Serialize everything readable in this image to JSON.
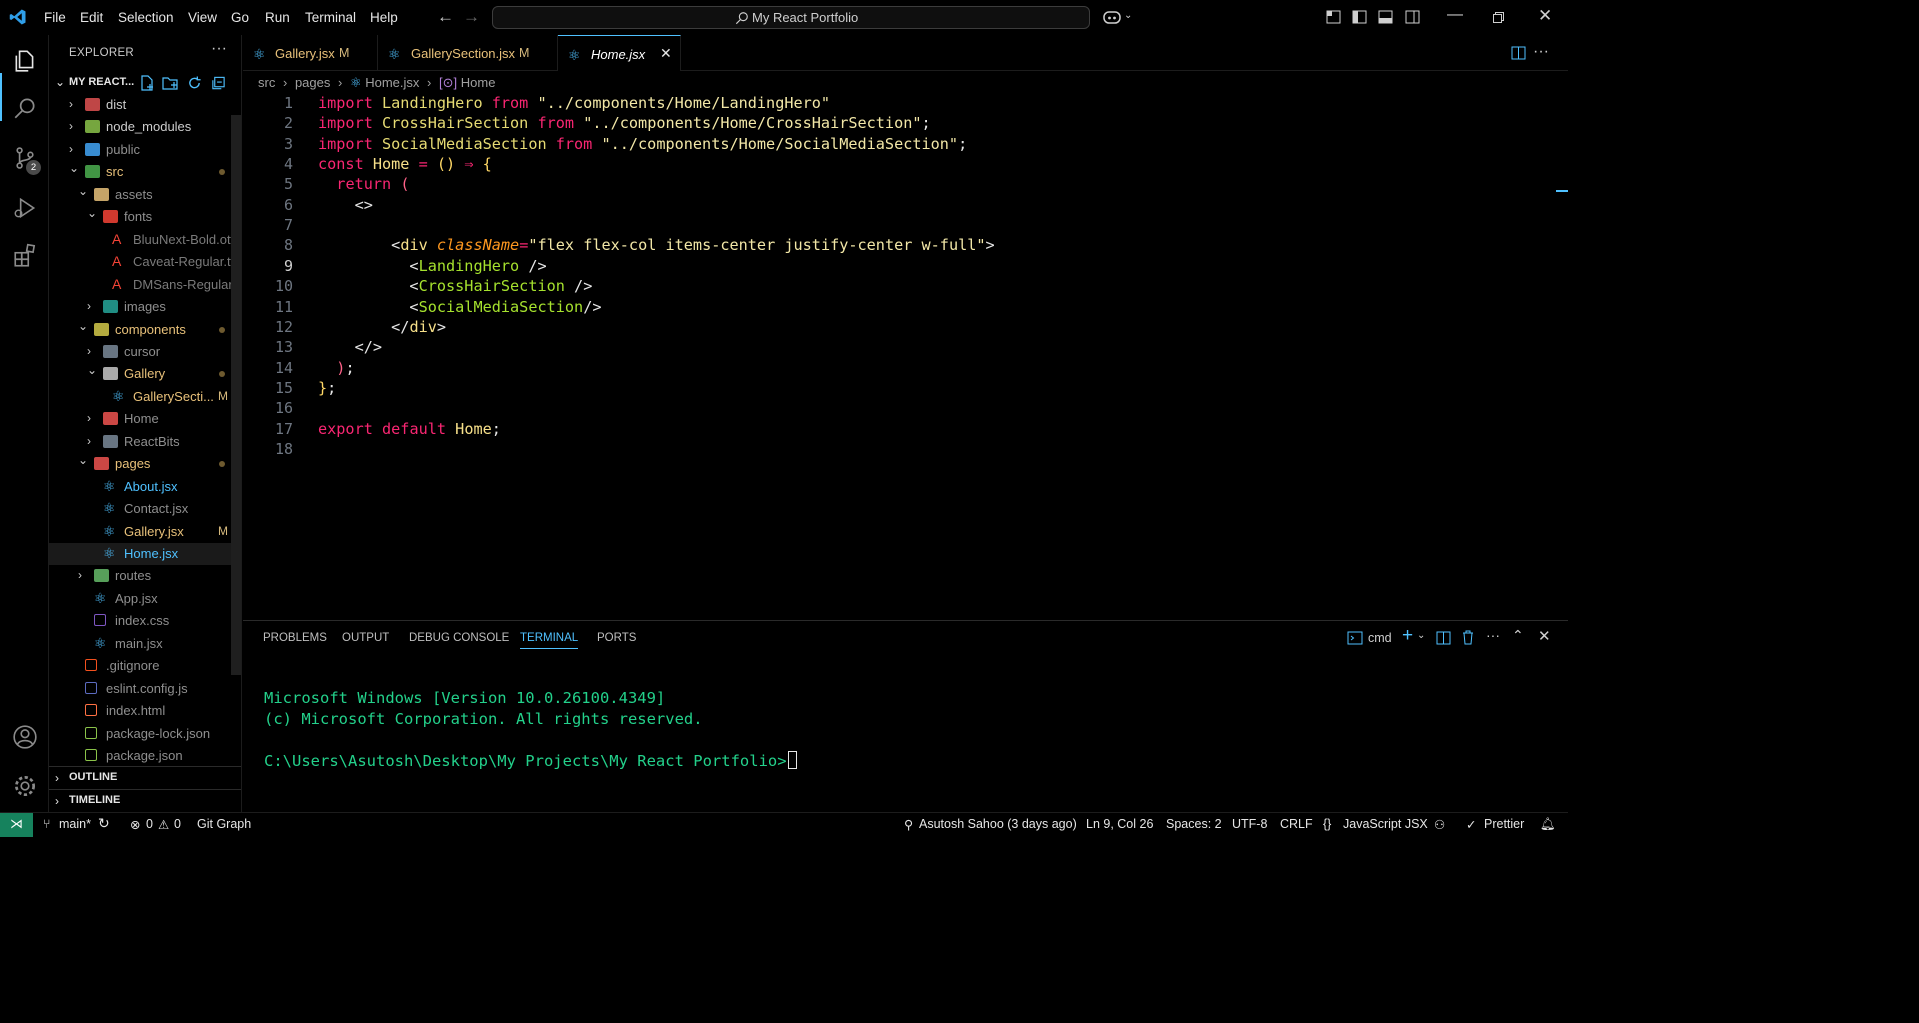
{
  "menu": [
    "File",
    "Edit",
    "Selection",
    "View",
    "Go",
    "Run",
    "Terminal",
    "Help"
  ],
  "search": {
    "text": "My React Portfolio"
  },
  "sidebar": {
    "title": "EXPLORER",
    "project": "MY REACT...",
    "outline": "OUTLINE",
    "timeline": "TIMELINE",
    "tree": [
      {
        "label": "dist",
        "indent": 0,
        "chev": ">",
        "icon": "folder-dist",
        "color": "#cccccc"
      },
      {
        "label": "node_modules",
        "indent": 0,
        "chev": ">",
        "icon": "folder-node",
        "color": "#cccccc"
      },
      {
        "label": "public",
        "indent": 0,
        "chev": ">",
        "icon": "folder-public",
        "color": "#8f8f8f"
      },
      {
        "label": "src",
        "indent": 0,
        "chev": "v",
        "icon": "folder-src",
        "color": "#e8c17a",
        "dot": true
      },
      {
        "label": "assets",
        "indent": 1,
        "chev": "v",
        "icon": "folder-assets",
        "color": "#8f8f8f"
      },
      {
        "label": "fonts",
        "indent": 2,
        "chev": "v",
        "icon": "folder-fonts",
        "color": "#8f8f8f"
      },
      {
        "label": "BluuNext-Bold.otf",
        "indent": 3,
        "chev": "",
        "icon": "font-file",
        "color": "#7a7a7a"
      },
      {
        "label": "Caveat-Regular.ttf",
        "indent": 3,
        "chev": "",
        "icon": "font-file",
        "color": "#7a7a7a"
      },
      {
        "label": "DMSans-Regular...",
        "indent": 3,
        "chev": "",
        "icon": "font-file",
        "color": "#7a7a7a"
      },
      {
        "label": "images",
        "indent": 2,
        "chev": ">",
        "icon": "folder-images",
        "color": "#8f8f8f"
      },
      {
        "label": "components",
        "indent": 1,
        "chev": "v",
        "icon": "folder-components",
        "color": "#e8c17a",
        "dot": true
      },
      {
        "label": "cursor",
        "indent": 2,
        "chev": ">",
        "icon": "folder-plain",
        "color": "#8f8f8f"
      },
      {
        "label": "Gallery",
        "indent": 2,
        "chev": "v",
        "icon": "folder-gallery",
        "color": "#e8c17a",
        "dot": true
      },
      {
        "label": "GallerySecti...",
        "indent": 3,
        "chev": "",
        "icon": "react-file",
        "color": "#e8c17a",
        "badge": "M"
      },
      {
        "label": "Home",
        "indent": 2,
        "chev": ">",
        "icon": "folder-home",
        "color": "#8f8f8f"
      },
      {
        "label": "ReactBits",
        "indent": 2,
        "chev": ">",
        "icon": "folder-plain",
        "color": "#8f8f8f"
      },
      {
        "label": "pages",
        "indent": 1,
        "chev": "v",
        "icon": "folder-pages",
        "color": "#e8c17a",
        "dot": true
      },
      {
        "label": "About.jsx",
        "indent": 2,
        "chev": "",
        "icon": "react-file",
        "color": "#4fc1ff"
      },
      {
        "label": "Contact.jsx",
        "indent": 2,
        "chev": "",
        "icon": "react-file",
        "color": "#8f8f8f"
      },
      {
        "label": "Gallery.jsx",
        "indent": 2,
        "chev": "",
        "icon": "react-file",
        "color": "#e8c17a",
        "badge": "M"
      },
      {
        "label": "Home.jsx",
        "indent": 2,
        "chev": "",
        "icon": "react-file",
        "color": "#4fc1ff",
        "selected": true
      },
      {
        "label": "routes",
        "indent": 1,
        "chev": ">",
        "icon": "folder-routes",
        "color": "#8f8f8f"
      },
      {
        "label": "App.jsx",
        "indent": 1,
        "chev": "",
        "icon": "react-file",
        "color": "#8f8f8f"
      },
      {
        "label": "index.css",
        "indent": 1,
        "chev": "",
        "icon": "css-file",
        "color": "#8f8f8f"
      },
      {
        "label": "main.jsx",
        "indent": 1,
        "chev": "",
        "icon": "react-file",
        "color": "#8f8f8f"
      },
      {
        "label": ".gitignore",
        "indent": 0,
        "chev": "",
        "icon": "git-file",
        "color": "#8f8f8f"
      },
      {
        "label": "eslint.config.js",
        "indent": 0,
        "chev": "",
        "icon": "eslint-file",
        "color": "#8f8f8f"
      },
      {
        "label": "index.html",
        "indent": 0,
        "chev": "",
        "icon": "html-file",
        "color": "#8f8f8f"
      },
      {
        "label": "package-lock.json",
        "indent": 0,
        "chev": "",
        "icon": "npm-file",
        "color": "#8f8f8f"
      },
      {
        "label": "package.json",
        "indent": 0,
        "chev": "",
        "icon": "npm-file",
        "color": "#8f8f8f"
      }
    ]
  },
  "tabs": [
    {
      "label": "Gallery.jsx",
      "modified": "M",
      "active": false
    },
    {
      "label": "GallerySection.jsx",
      "modified": "M",
      "active": false
    },
    {
      "label": "Home.jsx",
      "modified": "",
      "active": true
    }
  ],
  "breadcrumb": [
    "src",
    "pages",
    "Home.jsx",
    "Home"
  ],
  "editor": {
    "active_line": 9,
    "line_numbers": [
      "1",
      "2",
      "3",
      "4",
      "5",
      "6",
      "7",
      "8",
      "9",
      "10",
      "11",
      "12",
      "13",
      "14",
      "15",
      "16",
      "17",
      "18"
    ],
    "lines": [
      [
        [
          "kw",
          "import "
        ],
        [
          "id",
          "LandingHero "
        ],
        [
          "kw",
          "from "
        ],
        [
          "strw",
          "\"../components/Home/LandingHero\""
        ]
      ],
      [
        [
          "kw",
          "import "
        ],
        [
          "id",
          "CrossHairSection "
        ],
        [
          "kw",
          "from "
        ],
        [
          "strw",
          "\"../components/Home/CrossHairSection\""
        ],
        [
          "pun",
          ";"
        ]
      ],
      [
        [
          "kw",
          "import "
        ],
        [
          "id",
          "SocialMediaSection "
        ],
        [
          "kw",
          "from "
        ],
        [
          "strw",
          "\"../components/Home/SocialMediaSection\""
        ],
        [
          "pun",
          ";"
        ]
      ],
      [
        [
          "kw",
          "const "
        ],
        [
          "idy",
          "Home "
        ],
        [
          "kw",
          "= "
        ],
        [
          "paren",
          "() "
        ],
        [
          "kw",
          "⇒ "
        ],
        [
          "paren",
          "{"
        ]
      ],
      [
        [
          "pun",
          "  "
        ],
        [
          "kw",
          "return "
        ],
        [
          "pink",
          "("
        ]
      ],
      [
        [
          "pun",
          "    "
        ],
        [
          "pun",
          "<>"
        ]
      ],
      [
        [
          "pun",
          ""
        ]
      ],
      [
        [
          "pun",
          "        "
        ],
        [
          "pun",
          "<"
        ],
        [
          "idy",
          "div "
        ],
        [
          "attr",
          "className"
        ],
        [
          "kw",
          "="
        ],
        [
          "strw",
          "\"flex flex-col items-center justify-center w-full\""
        ],
        [
          "pun",
          ">"
        ]
      ],
      [
        [
          "pun",
          "          <"
        ],
        [
          "comp",
          "LandingHero "
        ],
        [
          "pun",
          "/>"
        ]
      ],
      [
        [
          "pun",
          "          <"
        ],
        [
          "comp",
          "CrossHairSection "
        ],
        [
          "pun",
          "/>"
        ]
      ],
      [
        [
          "pun",
          "          <"
        ],
        [
          "comp",
          "SocialMediaSection"
        ],
        [
          "pun",
          "/>"
        ]
      ],
      [
        [
          "pun",
          "        </"
        ],
        [
          "idy",
          "div"
        ],
        [
          "pun",
          ">"
        ]
      ],
      [
        [
          "pun",
          "    </>"
        ]
      ],
      [
        [
          "pun",
          "  "
        ],
        [
          "pink",
          ")"
        ],
        [
          "pun",
          ";"
        ]
      ],
      [
        [
          "paren",
          "}"
        ],
        [
          "pun",
          ";"
        ]
      ],
      [
        [
          "pun",
          ""
        ]
      ],
      [
        [
          "kw",
          "export "
        ],
        [
          "kw",
          "default "
        ],
        [
          "idy",
          "Home"
        ],
        [
          "pun",
          ";"
        ]
      ],
      [
        [
          "pun",
          ""
        ]
      ]
    ]
  },
  "panel": {
    "tabs": [
      "PROBLEMS",
      "OUTPUT",
      "DEBUG CONSOLE",
      "TERMINAL",
      "PORTS"
    ],
    "active_tab": "TERMINAL",
    "shell": "cmd",
    "terminal_lines": [
      "Microsoft Windows [Version 10.0.26100.4349]",
      "(c) Microsoft Corporation. All rights reserved.",
      "",
      "C:\\Users\\Asutosh\\Desktop\\My Projects\\My React Portfolio>"
    ]
  },
  "status": {
    "branch": "main*",
    "errors": "0",
    "warnings": "0",
    "git_graph": "Git Graph",
    "blame": "Asutosh Sahoo (3 days ago)",
    "position": "Ln 9, Col 26",
    "spaces": "Spaces: 2",
    "encoding": "UTF-8",
    "eol": "CRLF",
    "language": "JavaScript JSX",
    "formatter": "Prettier"
  },
  "colors": {
    "accent": "#4fc1ff",
    "modified": "#d7ba7d",
    "terminal_text": "#23d18b",
    "remote": "#16825d"
  },
  "badges": {
    "source_control": "2"
  }
}
